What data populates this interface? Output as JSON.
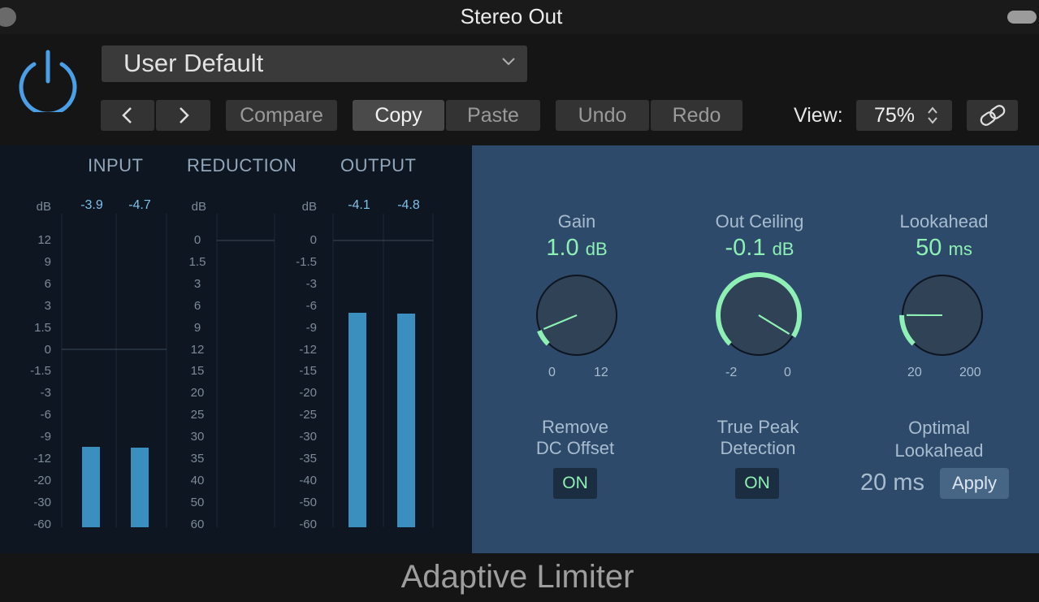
{
  "window": {
    "title": "Stereo Out"
  },
  "header": {
    "preset": "User Default",
    "compare_label": "Compare",
    "copy_label": "Copy",
    "paste_label": "Paste",
    "undo_label": "Undo",
    "redo_label": "Redo",
    "view_label": "View:",
    "view_value": "75%",
    "prev_label": "‹",
    "next_label": "›"
  },
  "meters": {
    "input": {
      "header": "INPUT",
      "unit": "dB",
      "peaks": [
        "-3.9",
        "-4.7"
      ],
      "scale": [
        "12",
        "9",
        "6",
        "3",
        "1.5",
        "0",
        "-1.5",
        "-3",
        "-6",
        "-9",
        "-12",
        "-20",
        "-30",
        "-60"
      ],
      "levels": [
        0.28,
        0.277
      ]
    },
    "reduction": {
      "header": "REDUCTION",
      "unit": "dB",
      "scale": [
        "0",
        "1.5",
        "3",
        "6",
        "9",
        "12",
        "15",
        "20",
        "25",
        "30",
        "35",
        "40",
        "50",
        "60"
      ]
    },
    "output": {
      "header": "OUTPUT",
      "unit": "dB",
      "peaks": [
        "-4.1",
        "-4.8"
      ],
      "scale": [
        "0",
        "-1.5",
        "-3",
        "-6",
        "-9",
        "-12",
        "-15",
        "-20",
        "-25",
        "-30",
        "-35",
        "-40",
        "-50",
        "-60"
      ],
      "levels": [
        0.745,
        0.74
      ]
    }
  },
  "controls": {
    "gain": {
      "label": "Gain",
      "value": "1.0",
      "unit": "dB",
      "min": "0",
      "max": "12",
      "fraction": 0.083
    },
    "out_ceiling": {
      "label": "Out Ceiling",
      "value": "-0.1",
      "unit": "dB",
      "min": "-2",
      "max": "0",
      "fraction": 0.95
    },
    "lookahead": {
      "label": "Lookahead",
      "value": "50",
      "unit": "ms",
      "min": "20",
      "max": "200",
      "fraction": 0.167
    },
    "remove_dc": {
      "label_line1": "Remove",
      "label_line2": "DC Offset",
      "state": "ON"
    },
    "true_peak": {
      "label_line1": "True Peak",
      "label_line2": "Detection",
      "state": "ON"
    },
    "optimal": {
      "label_line1": "Optimal",
      "label_line2": "Lookahead",
      "value": "20 ms",
      "apply_label": "Apply"
    }
  },
  "footer": {
    "plugin_name": "Adaptive Limiter"
  },
  "colors": {
    "accent_green": "#8ef0b4",
    "meter_blue": "#3a8fbf",
    "power_blue": "#4a9fe6"
  }
}
